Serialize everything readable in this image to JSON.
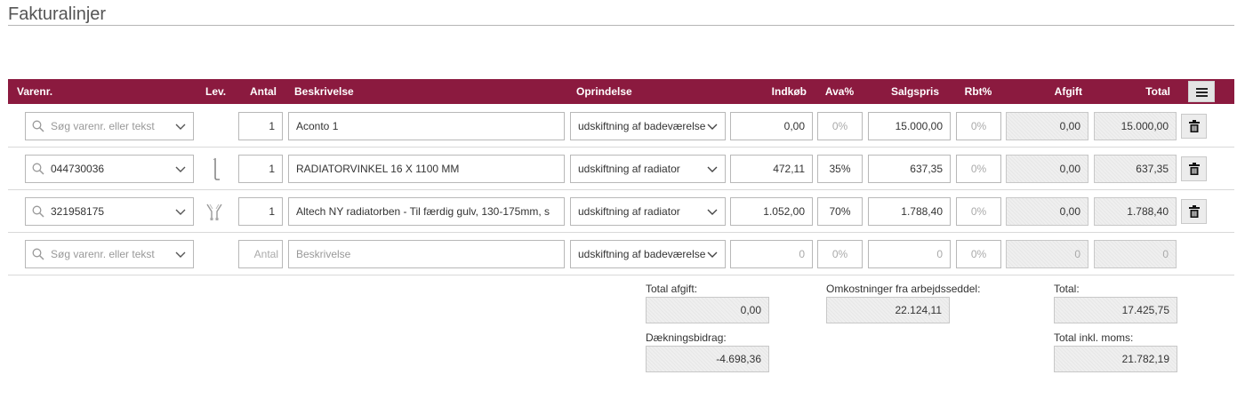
{
  "page": {
    "title": "Fakturalinjer"
  },
  "colors": {
    "header_bg": "#8b1a3f",
    "readonly_bg": "#efefef",
    "border": "#b8b8b8"
  },
  "columns": {
    "varenr": "Varenr.",
    "lev": "Lev.",
    "antal": "Antal",
    "beskrivelse": "Beskrivelse",
    "oprindelse": "Oprindelse",
    "indkob": "Indkøb",
    "ava": "Ava%",
    "salgspris": "Salgspris",
    "rbt": "Rbt%",
    "afgift": "Afgift",
    "total": "Total"
  },
  "header_menu_icon": "hamburger-menu-icon",
  "rows": [
    {
      "varenr_value": "",
      "varenr_placeholder": "Søg varenr. eller tekst",
      "lev_icon": "",
      "antal": "1",
      "beskrivelse": "Aconto 1",
      "oprindelse": "udskiftning af badeværelse",
      "indkob": "0,00",
      "ava": "0%",
      "salgspris": "15.000,00",
      "rbt": "0%",
      "afgift": "0,00",
      "total": "15.000,00",
      "delete_icon": "trash-icon"
    },
    {
      "varenr_value": "044730036",
      "varenr_placeholder": "",
      "lev_icon": "radiator-bracket-image",
      "antal": "1",
      "beskrivelse": "RADIATORVINKEL 16 X 1100 MM",
      "oprindelse": "udskiftning af radiator",
      "indkob": "472,11",
      "ava": "35%",
      "salgspris": "637,35",
      "rbt": "0%",
      "afgift": "0,00",
      "total": "637,35",
      "delete_icon": "trash-icon"
    },
    {
      "varenr_value": "321958175",
      "varenr_placeholder": "",
      "lev_icon": "radiator-pipe-image",
      "antal": "1",
      "beskrivelse": "Altech NY radiatorben - Til færdig gulv, 130-175mm, s",
      "oprindelse": "udskiftning af radiator",
      "indkob": "1.052,00",
      "ava": "70%",
      "salgspris": "1.788,40",
      "rbt": "0%",
      "afgift": "0,00",
      "total": "1.788,40",
      "delete_icon": "trash-icon"
    }
  ],
  "new_row": {
    "varenr_placeholder": "Søg varenr. eller tekst",
    "antal_placeholder": "Antal",
    "beskrivelse_placeholder": "Beskrivelse",
    "oprindelse": "udskiftning af badeværelse",
    "indkob": "0",
    "ava": "0%",
    "salgspris": "0",
    "rbt": "0%",
    "afgift": "0",
    "total": "0"
  },
  "summary": {
    "total_afgift_label": "Total afgift:",
    "total_afgift": "0,00",
    "daekningsbidrag_label": "Dækningsbidrag:",
    "daekningsbidrag": "-4.698,36",
    "omkostninger_label": "Omkostninger fra arbejdsseddel:",
    "omkostninger": "22.124,11",
    "total_label": "Total:",
    "total": "17.425,75",
    "total_inkl_moms_label": "Total inkl. moms:",
    "total_inkl_moms": "21.782,19"
  }
}
